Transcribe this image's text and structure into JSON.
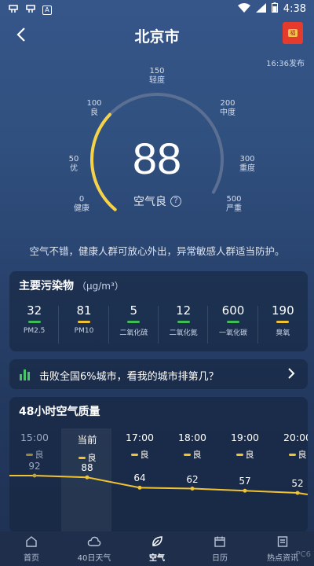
{
  "status_bar": {
    "time": "4:38",
    "left_icons": [
      "app-notification-icon",
      "app-notification-icon",
      "a-notification-icon"
    ],
    "right_icons": [
      "wifi-icon",
      "signal-icon",
      "battery-icon"
    ]
  },
  "header": {
    "title": "北京市",
    "publish_time": "16:36发布"
  },
  "gauge": {
    "aqi": "88",
    "aqi_fraction": 0.176,
    "level_text": "空气良",
    "scale": [
      {
        "value": "0",
        "label": "健康"
      },
      {
        "value": "50",
        "label": "优"
      },
      {
        "value": "100",
        "label": "良"
      },
      {
        "value": "150",
        "label": "轻度"
      },
      {
        "value": "200",
        "label": "中度"
      },
      {
        "value": "300",
        "label": "重度"
      },
      {
        "value": "500",
        "label": "严重"
      }
    ],
    "colors": {
      "track": "#5b6f93",
      "fill": "#f4d24a"
    }
  },
  "advice": "空气不错，健康人群可放心外出，异常敏感人群适当防护。",
  "pollutants": {
    "title": "主要污染物",
    "unit": "（μg/m³）",
    "items": [
      {
        "value": "32",
        "name": "PM2.5",
        "color": "#3dbf55"
      },
      {
        "value": "81",
        "name": "PM10",
        "color": "#f1c232"
      },
      {
        "value": "5",
        "name": "二氧化硫",
        "color": "#3dbf55"
      },
      {
        "value": "12",
        "name": "二氧化氮",
        "color": "#3dbf55"
      },
      {
        "value": "600",
        "name": "一氧化碳",
        "color": "#3dbf55"
      },
      {
        "value": "190",
        "name": "臭氧",
        "color": "#f1c232"
      }
    ]
  },
  "ranking": {
    "text": "击败全国6%城市，看我的城市排第几？"
  },
  "hourly": {
    "title": "48小时空气质量",
    "hours": [
      {
        "time": "15:00",
        "level": "良",
        "aqi": "92",
        "aqi_num": 92,
        "past": true
      },
      {
        "time": "当前",
        "level": "良",
        "aqi": "88",
        "aqi_num": 88,
        "past": false
      },
      {
        "time": "17:00",
        "level": "良",
        "aqi": "64",
        "aqi_num": 64,
        "past": false
      },
      {
        "time": "18:00",
        "level": "良",
        "aqi": "62",
        "aqi_num": 62,
        "past": false
      },
      {
        "time": "19:00",
        "level": "良",
        "aqi": "57",
        "aqi_num": 57,
        "past": false
      },
      {
        "time": "20:00",
        "level": "良",
        "aqi": "52",
        "aqi_num": 52,
        "past": false
      }
    ],
    "line_color": "#f1c232"
  },
  "tabs": [
    {
      "label": "首页",
      "icon": "home-icon"
    },
    {
      "label": "40日天气",
      "icon": "cloud-icon"
    },
    {
      "label": "空气",
      "icon": "leaf-icon",
      "active": true
    },
    {
      "label": "日历",
      "icon": "calendar-icon"
    },
    {
      "label": "热点资讯",
      "icon": "news-icon"
    }
  ]
}
